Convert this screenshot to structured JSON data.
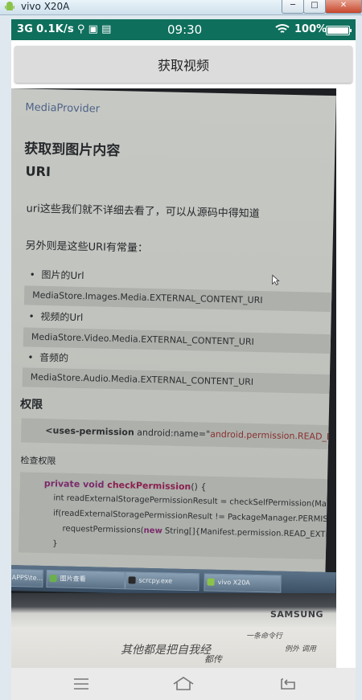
{
  "window": {
    "title": "vivo X20A",
    "minimize_label": "─",
    "maximize_label": "□",
    "close_label": "✕"
  },
  "status_bar": {
    "network": "3G",
    "speed": "0.1K/s",
    "icons_left": [
      "usb-icon",
      "nfc-icon",
      "sd-icon"
    ],
    "time": "09:30",
    "battery_text": "100%"
  },
  "app": {
    "button_label": "获取视频"
  },
  "photo": {
    "header": "MediaProvider",
    "h1": "获取到图片内容",
    "h2": "URI",
    "p1": "uri这些我们就不详细去看了，可以从源码中得知道",
    "p2": "另外则是这些URI有常量：",
    "items": [
      {
        "bullet": "图片的Url",
        "code": "MediaStore.Images.Media.EXTERNAL_CONTENT_URI"
      },
      {
        "bullet": "视频的Url",
        "code": "MediaStore.Video.Media.EXTERNAL_CONTENT_URI"
      },
      {
        "bullet": "音频的",
        "code": "MediaStore.Audio.Media.EXTERNAL_CONTENT_URI"
      }
    ],
    "perm_heading": "权限",
    "perm_code_tag": "<uses-permission",
    "perm_code_attr": " android:name=\"",
    "perm_code_value": "android.permission.READ_EXTERN",
    "check_heading": "检查权限",
    "code_lines": {
      "l1_kw": "private void ",
      "l1_fn": "checkPermission",
      "l1_rest": "() {",
      "l2": "int readExternalStoragePermissionResult = checkSelfPermission(Mani",
      "l3": "if(readExternalStoragePermissionResult != PackageManager.PERMISSI",
      "l4_pre": "requestPermissions(",
      "l4_kw": "new",
      "l4_rest": " String[]{Manifest.permission.READ_EXTERN",
      "l5": "}"
    },
    "taskbar": [
      "APPS\\te...",
      "图片查看",
      "scrcpy.exe",
      "vivo X20A"
    ],
    "monitor_brand": "SAMSUNG",
    "notes": [
      "其他都是把自我经",
      "都传",
      "一条命令行",
      "例外 调用"
    ]
  },
  "nav": {
    "icons": [
      "menu-icon",
      "home-icon",
      "back-icon"
    ]
  }
}
